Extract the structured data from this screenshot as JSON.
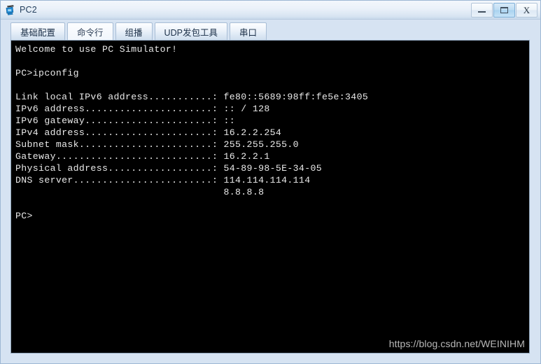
{
  "window": {
    "title": "PC2",
    "icon": "pc-device-icon",
    "buttons": [
      {
        "name": "minimize-button",
        "label": "–",
        "glyph": "minimize",
        "active": false
      },
      {
        "name": "maximize-button",
        "label": "□",
        "glyph": "maximize",
        "active": true
      },
      {
        "name": "close-button",
        "label": "X",
        "glyph": "close",
        "active": false
      }
    ]
  },
  "tabs": [
    {
      "name": "tab-basic-config",
      "label": "基础配置",
      "selected": false
    },
    {
      "name": "tab-command-line",
      "label": "命令行",
      "selected": true
    },
    {
      "name": "tab-multicast",
      "label": "组播",
      "selected": false
    },
    {
      "name": "tab-udp-packet-tool",
      "label": "UDP发包工具",
      "selected": false
    },
    {
      "name": "tab-serial-port",
      "label": "串口",
      "selected": false
    }
  ],
  "terminal": {
    "lines": [
      "Welcome to use PC Simulator!",
      "",
      "PC>ipconfig",
      "",
      "Link local IPv6 address...........: fe80::5689:98ff:fe5e:3405",
      "IPv6 address......................: :: / 128",
      "IPv6 gateway......................: ::",
      "IPv4 address......................: 16.2.2.254",
      "Subnet mask.......................: 255.255.255.0",
      "Gateway...........................: 16.2.2.1",
      "Physical address..................: 54-89-98-5E-34-05",
      "DNS server........................: 114.114.114.114",
      "                                    8.8.8.8",
      "",
      "PC>"
    ],
    "fields": {
      "link_local_ipv6_address": "fe80::5689:98ff:fe5e:3405",
      "ipv6_address": ":: / 128",
      "ipv6_gateway": "::",
      "ipv4_address": "16.2.2.254",
      "subnet_mask": "255.255.255.0",
      "gateway": "16.2.2.1",
      "physical_address": "54-89-98-5E-34-05",
      "dns_server_primary": "114.114.114.114",
      "dns_server_secondary": "8.8.8.8"
    },
    "prompt": "PC>",
    "command": "ipconfig",
    "colors": {
      "background": "#000000",
      "text": "#e9e9e9"
    }
  },
  "watermark": {
    "text": "https://blog.csdn.net/WEINIHM"
  }
}
